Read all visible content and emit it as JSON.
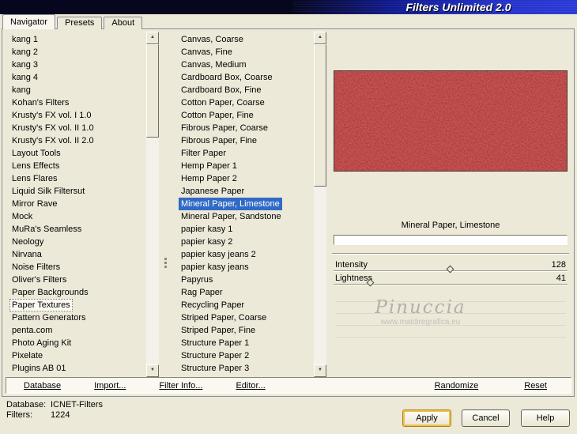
{
  "colors": {
    "dialog_bg": "#ece9d8",
    "selection_blue": "#316ac5",
    "banner_blue": "#2433cc",
    "preview_red": "#6e0b0b",
    "apply_focus_gold": "#f0c04a"
  },
  "banner": {
    "title": "Filters Unlimited 2.0"
  },
  "tabs": {
    "items": [
      {
        "label": "Navigator"
      },
      {
        "label": "Presets"
      },
      {
        "label": "About"
      }
    ],
    "active": "Navigator"
  },
  "icons": {
    "scroll_up": "▲",
    "scroll_down": "▼"
  },
  "lists": {
    "categories": [
      "kang 1",
      "kang 2",
      "kang 3",
      "kang 4",
      "kang",
      "Kohan's Filters",
      "Krusty's FX vol. I 1.0",
      "Krusty's FX vol. II 1.0",
      "Krusty's FX vol. II 2.0",
      "Layout Tools",
      "Lens Effects",
      "Lens Flares",
      "Liquid Silk Filtersut",
      "Mirror Rave",
      "Mock",
      "MuRa's Seamless",
      "Neology",
      "Nirvana",
      "Noise Filters",
      "Oliver's Filters",
      "Paper Backgrounds",
      "Paper Textures",
      "Pattern Generators",
      "penta.com",
      "Photo Aging Kit",
      "Pixelate",
      "Plugins AB 01"
    ],
    "selected_category": "Paper Textures",
    "filters": [
      "Canvas, Coarse",
      "Canvas, Fine",
      "Canvas, Medium",
      "Cardboard Box, Coarse",
      "Cardboard Box, Fine",
      "Cotton Paper, Coarse",
      "Cotton Paper, Fine",
      "Fibrous Paper, Coarse",
      "Fibrous Paper, Fine",
      "Filter Paper",
      "Hemp Paper 1",
      "Hemp Paper 2",
      "Japanese Paper",
      "Mineral Paper, Limestone",
      "Mineral Paper, Sandstone",
      "papier kasy 1",
      "papier kasy 2",
      "papier kasy jeans 2",
      "papier kasy jeans",
      "Papyrus",
      "Rag Paper",
      "Recycling Paper",
      "Striped Paper, Coarse",
      "Striped Paper, Fine",
      "Structure Paper 1",
      "Structure Paper 2",
      "Structure Paper 3"
    ],
    "selected_filter": "Mineral Paper, Limestone"
  },
  "preview": {
    "caption": "Mineral Paper, Limestone"
  },
  "sliders": [
    {
      "label": "Intensity",
      "value": "128",
      "pos_pct": 50
    },
    {
      "label": "Lightness",
      "value": "41",
      "pos_pct": 16
    }
  ],
  "watermark": {
    "name": "Pinuccia",
    "url": "www.maidiregrafica.eu"
  },
  "toolbar": {
    "database": "Database",
    "import": "Import...",
    "filter_info": "Filter Info...",
    "editor": "Editor...",
    "randomize": "Randomize",
    "reset": "Reset"
  },
  "status": {
    "database_label": "Database:",
    "database_value": "ICNET-Filters",
    "filters_label": "Filters:",
    "filters_value": "1224"
  },
  "buttons": {
    "apply": "Apply",
    "cancel": "Cancel",
    "help": "Help"
  }
}
